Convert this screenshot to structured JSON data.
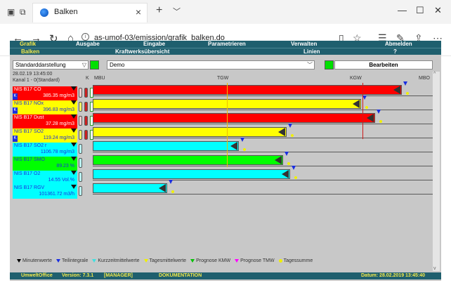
{
  "browser": {
    "tab_title": "Balken",
    "tab_close": "×",
    "new_tab": "+",
    "url": "as-umof-03/emission/grafik_balken.do"
  },
  "menu": {
    "row1": [
      "Grafik",
      "Ausgabe",
      "Eingabe",
      "Parametrieren",
      "Verwalten",
      "Abmelden"
    ],
    "row2": [
      "Balken",
      "Kraftwerksübersicht",
      "Linien",
      "?"
    ]
  },
  "controls": {
    "view_select": "Standarddarstellung",
    "profile_select": "Demo",
    "edit_button": "Bearbeiten"
  },
  "header": {
    "datetime": "28.02.19 13:45:00",
    "kanal": "Kanal 1 - 0(Standard)",
    "k_label": "K",
    "mbu": "MBU",
    "tgw": "TGW",
    "kgw": "KGW",
    "mbo": "MBO"
  },
  "channels": [
    {
      "name": "NIS B17 CO",
      "value": "385.35 mg/m3",
      "color": "#ff0000",
      "bar_color": "#ff0000",
      "fill": 0.91,
      "k": "K"
    },
    {
      "name": "NIS B17 NOx",
      "value": "396.83 mg/m3",
      "color": "#ffff00",
      "bar_color": "#ffff00",
      "fill": 0.79,
      "k": "K"
    },
    {
      "name": "NIS B17 Dust",
      "value": "37.28 mg/m3",
      "color": "#ff0000",
      "bar_color": "#ff0000",
      "fill": 0.83,
      "k": ""
    },
    {
      "name": "NIS B17 SO2",
      "value": "119.24 mg/m3",
      "color": "#ffff00",
      "bar_color": "#ffff00",
      "fill": 0.57,
      "k": "K"
    },
    {
      "name": "NIS B17 SO2 r",
      "value": "1106.78 mg/m3",
      "color": "#00ffff",
      "bar_color": "#00ffff",
      "fill": 0.43,
      "k": ""
    },
    {
      "name": "NIS B17 SMO",
      "value": "89.23 %",
      "color": "#00ff00",
      "bar_color": "#00ff00",
      "fill": 0.56,
      "k": ""
    },
    {
      "name": "NIS B17 O2",
      "value": "14.55 Vol.%",
      "color": "#00ffff",
      "bar_color": "#00ffff",
      "fill": 0.58,
      "k": ""
    },
    {
      "name": "NIS B17 RGV",
      "value": "101361.72 m3/h",
      "color": "#00ffff",
      "bar_color": "#00ffff",
      "fill": 0.22,
      "k": ""
    }
  ],
  "legend": [
    {
      "label": "Minutenwerte",
      "color": "#000000",
      "shape": "triangle"
    },
    {
      "label": "Teilintegrale",
      "color": "#1a2ee0",
      "shape": "triangle"
    },
    {
      "label": "Kurzzeitmittelwerte",
      "color": "#40e0e0",
      "shape": "triangle"
    },
    {
      "label": "Tagesmittelwerte",
      "color": "#f0f000",
      "shape": "triangle"
    },
    {
      "label": "Prognose KMW",
      "color": "#00c000",
      "shape": "triangle"
    },
    {
      "label": "Prognose TMW",
      "color": "#ff00ff",
      "shape": "triangle"
    },
    {
      "label": "Tagessumme",
      "color": "#f0f000",
      "shape": "dot"
    }
  ],
  "status": {
    "product": "UmweltOffice",
    "version": "Version: 7.3.1",
    "role": "[MANAGER]",
    "doc": "DOKUMENTATION",
    "date": "Datum: 28.02.2019 13:45:40"
  }
}
